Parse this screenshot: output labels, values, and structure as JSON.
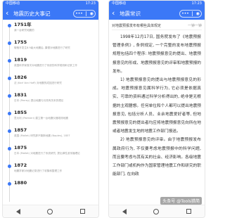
{
  "left": {
    "status": {
      "carrier": "中国移动",
      "time": "17:23"
    },
    "title": "地震历史大事记",
    "capsule": {
      "more": "•••",
      "close": "◉"
    },
    "events": [
      {
        "year": "1751年",
        "desc": "我一台研究地震的"
      },
      {
        "year": "1755",
        "desc": "葡萄牙发生8.9级大地震后, 康德对地震进行了研究"
      },
      {
        "year": "1819",
        "desc": "英国科学家首次对地震进行了系统的科学观测和记录工作"
      },
      {
        "year": "1826",
        "desc": "法 (Karl Von Hoff) 对地震的成因进行研究"
      },
      {
        "year": "1831",
        "desc": "日本 (Perrey) 提出地震与月亮有关系的理论"
      },
      {
        "year": "1855",
        "desc": "意大利 (Palmieri) 建立第一台地震仪器观测地震"
      },
      {
        "year": "1857",
        "desc": "英国 (Mallet) 研究那不勒斯地震 (Naples), 1857"
      },
      {
        "year": "1875",
        "desc": "日本 (Mallet) 对地震进行了系统研究, 提出弹性波传播理论"
      },
      {
        "year": "1872",
        "desc": "地震学家对地震记录进行了收集和整理工作"
      },
      {
        "year": "1880",
        "desc": ""
      }
    ]
  },
  "right": {
    "status": {
      "carrier": "中国移动",
      "time": "17:23"
    },
    "title": "地震常识",
    "capsule": {
      "more": "•••",
      "close": "◉"
    },
    "subtitle": {
      "text": "对地震预报发布有哪些具体规定",
      "right": "一钟一钟"
    },
    "paragraphs": [
      "1998年12月17日, 国务院发布了《地震预报管理条例》, 条例规定, 一个完整的发布地震预报规程包括四个程序: 地震预报意见的提出、地震预报意见的形成、地震预报意见的评审和地震预报的发布。",
      "1) 地震预报意见的提出与地震预报意见的形成。地震预报意见属科学行为, 它必须是依据真实、可靠的资料通过科学分析得出的, 绝非是无根据的主观臆想。任何单位和个人都可以提出地震预报意见, 包括分析人员、业余地震爱好者等, 但地震预报意见的提出者均应将地震预报意见向所在地或者地震发生地的地震工作部门报送。",
      "2) 地震预报意见的评审。由于地震预报发布属政府行为, 不仅要考虑地震预报中的科学问题, 而且要考虑与其有关的社会、经济影响。各级地震工作部门或机构作为国家管理地震工作和研究的职能部门, 在向政"
    ]
  },
  "watermark": "头条号 @Tools猎简"
}
